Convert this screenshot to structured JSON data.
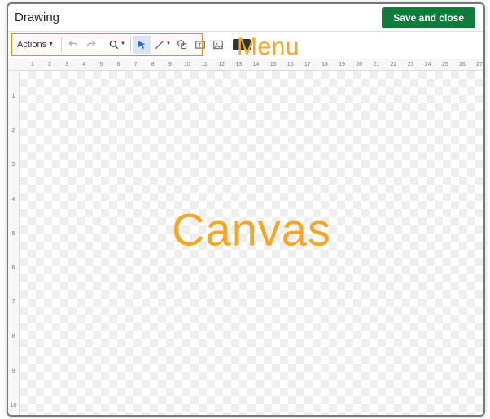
{
  "header": {
    "title": "Drawing",
    "save_label": "Save and close"
  },
  "toolbar": {
    "actions_label": "Actions",
    "icons": {
      "undo": "undo-icon",
      "redo": "redo-icon",
      "zoom": "zoom-icon",
      "select": "select-arrow-icon",
      "line": "line-icon",
      "shape": "shape-icon",
      "textbox": "textbox-icon",
      "image": "image-icon",
      "more": "more-icon"
    }
  },
  "annotations": {
    "menu_label": "Menu",
    "canvas_label": "Canvas",
    "color": "#f5a623"
  },
  "ruler": {
    "h_ticks": [
      "",
      "1",
      "",
      "2",
      "",
      "3",
      "",
      "4",
      "",
      "5",
      "",
      "6",
      "",
      "7",
      "",
      "8",
      "",
      "9",
      "",
      "10",
      "",
      "11",
      "",
      "12",
      "",
      "13",
      "",
      "14",
      "",
      "15",
      "",
      "16",
      "",
      "17",
      "",
      "18",
      "",
      "19",
      "",
      "20",
      "",
      "21",
      "",
      "22",
      "",
      "23",
      "",
      "24",
      "",
      "25",
      "",
      "26",
      "",
      "27"
    ],
    "v_ticks": [
      "",
      "1",
      "",
      "2",
      "",
      "3",
      "",
      "4",
      "",
      "5",
      "",
      "6",
      "",
      "7",
      "",
      "8",
      "",
      "9",
      "",
      "10"
    ]
  }
}
